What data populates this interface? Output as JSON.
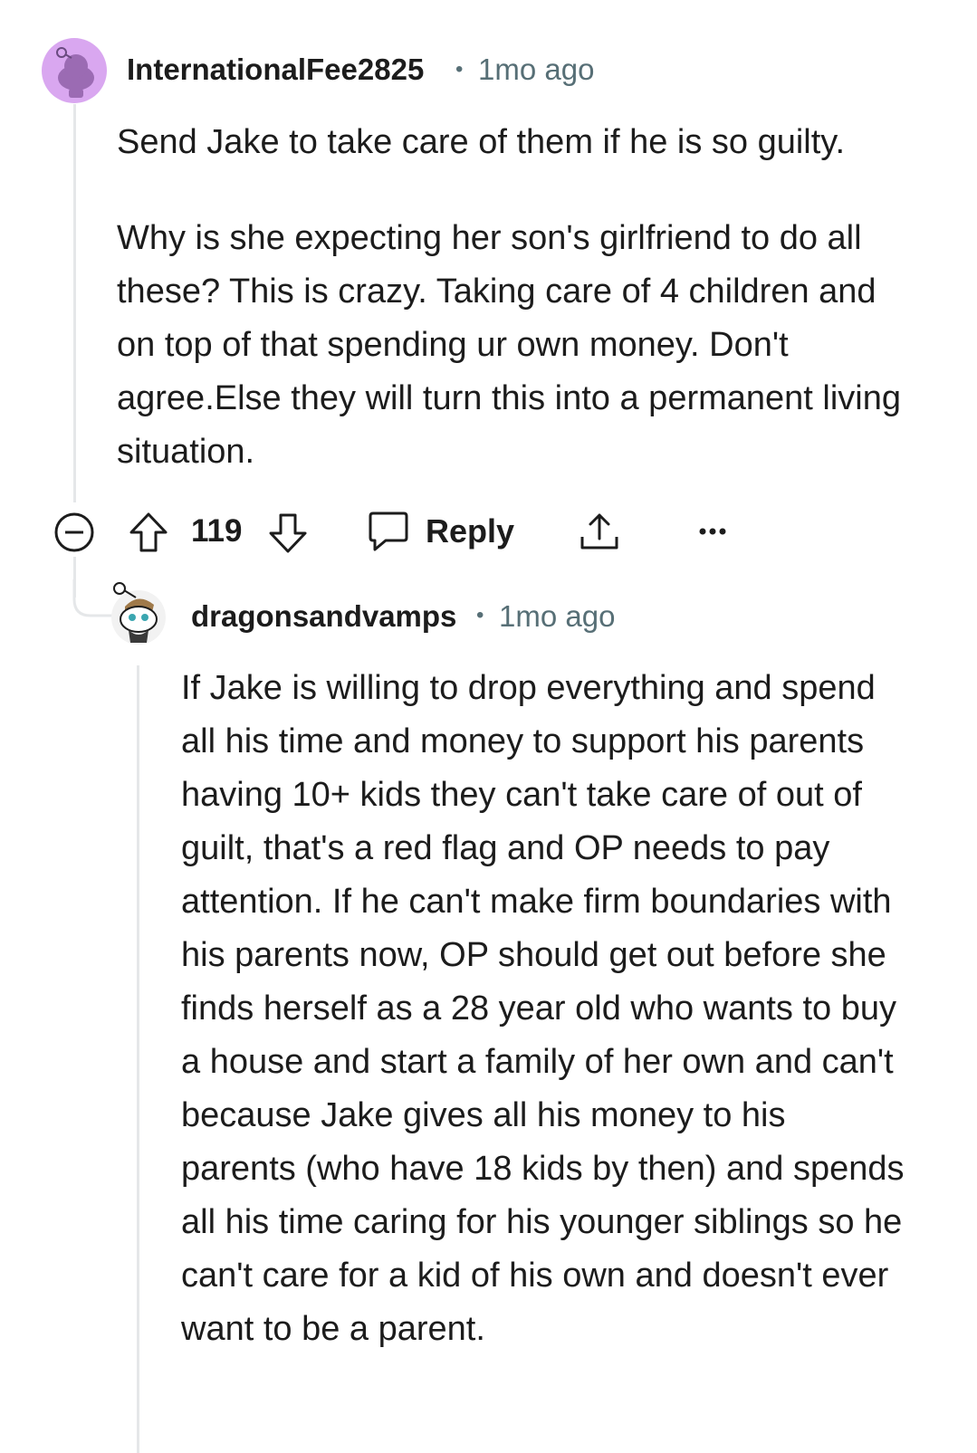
{
  "comments": [
    {
      "username": "InternationalFee2825",
      "separator": "•",
      "time": "1mo ago",
      "avatar_icon": "snoo-avatar-icon",
      "avatar_color": "#d9a7f0",
      "paragraphs": [
        "Send Jake to take care of them if he is so guilty.",
        "Why is she expecting her son's girlfriend to do all these? This is crazy. Taking care of 4 children and on top of that spending ur own money. Don't agree.Else they will turn this into a permanent living situation."
      ],
      "actions": {
        "collapse_icon": "collapse-minus-icon",
        "upvote_icon": "upvote-arrow-icon",
        "vote_count": "119",
        "downvote_icon": "downvote-arrow-icon",
        "reply_icon": "speech-bubble-icon",
        "reply_label": "Reply",
        "share_icon": "share-icon",
        "more_icon": "more-options-icon"
      }
    },
    {
      "username": "dragonsandvamps",
      "separator": "•",
      "time": "1mo ago",
      "avatar_icon": "snoo-avatar-icon",
      "paragraphs": [
        "If Jake is willing to drop everything and spend all his time and money to support his parents having 10+ kids they can't take care of out of guilt, that's a red flag and OP needs to pay attention. If he can't make firm boundaries with his parents now, OP should get out before she finds herself as a 28 year old who wants to buy a house and start a family of her own and can't because Jake gives all his money to his parents (who have 18 kids by then) and spends all his time caring for his younger siblings so he can't care for a kid of his own and doesn't ever want to be a parent."
      ]
    }
  ]
}
